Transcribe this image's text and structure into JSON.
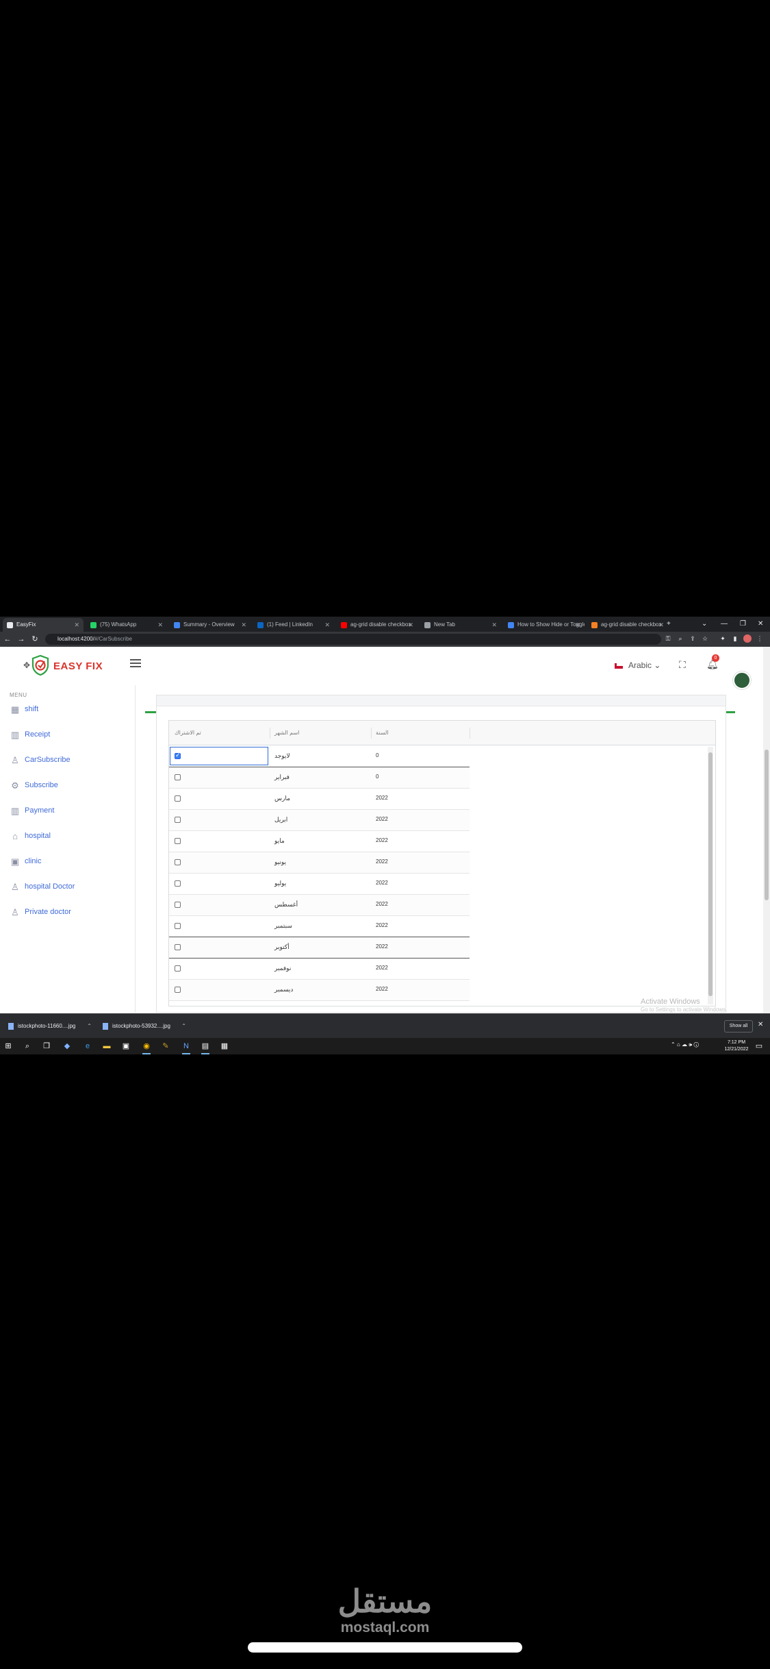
{
  "browser": {
    "tabs": [
      {
        "label": "EasyFix",
        "active": true,
        "color": "#e8eaed"
      },
      {
        "label": "(75) WhatsApp",
        "active": false,
        "color": "#25d366"
      },
      {
        "label": "Summary - Overview",
        "active": false,
        "color": "#4285f4"
      },
      {
        "label": "(1) Feed | LinkedIn",
        "active": false,
        "color": "#0a66c2"
      },
      {
        "label": "ag-grid disable checkbox",
        "active": false,
        "color": "#ff0000"
      },
      {
        "label": "New Tab",
        "active": false,
        "color": "#9aa0a6"
      },
      {
        "label": "How to Show Hide or Toggle",
        "active": false,
        "color": "#4285f4"
      },
      {
        "label": "ag-grid disable checkbox",
        "active": false,
        "color": "#f48024"
      }
    ],
    "url_host": "localhost:4200/",
    "url_path": "#/CarSubscribe"
  },
  "header": {
    "logo_text": "EASY FIX",
    "language": "Arabic",
    "notification_count": "0",
    "accent_color": "#2ea043"
  },
  "sidebar": {
    "menu_label": "MENU",
    "items": [
      {
        "label": "shift",
        "icon": "grid-icon"
      },
      {
        "label": "Receipt",
        "icon": "building-icon"
      },
      {
        "label": "CarSubscribe",
        "icon": "user-icon"
      },
      {
        "label": "Subscribe",
        "icon": "settings-icon"
      },
      {
        "label": "Payment",
        "icon": "building-icon"
      },
      {
        "label": "hospital",
        "icon": "home-icon"
      },
      {
        "label": "clinic",
        "icon": "image-icon"
      },
      {
        "label": "hospital Doctor",
        "icon": "user-add-icon"
      },
      {
        "label": "Private doctor",
        "icon": "user-icon"
      }
    ]
  },
  "grid": {
    "headers": {
      "subscribed": "تم الاشتراك",
      "month_name": "اسم الشهر",
      "year": "السنة"
    },
    "rows": [
      {
        "month": "لايوجد",
        "year": "0",
        "checked": true,
        "focused": true
      },
      {
        "month": "فبراير",
        "year": "0",
        "checked": false
      },
      {
        "month": "مارس",
        "year": "2022",
        "checked": false
      },
      {
        "month": "ابريل",
        "year": "2022",
        "checked": false
      },
      {
        "month": "مايو",
        "year": "2022",
        "checked": false
      },
      {
        "month": "يونيو",
        "year": "2022",
        "checked": false
      },
      {
        "month": "يوليو",
        "year": "2022",
        "checked": false
      },
      {
        "month": "أغسطس",
        "year": "2022",
        "checked": false
      },
      {
        "month": "سبتمبر",
        "year": "2022",
        "checked": false
      },
      {
        "month": "أكتوبر",
        "year": "2022",
        "checked": false
      },
      {
        "month": "نوفمبر",
        "year": "2022",
        "checked": false
      },
      {
        "month": "ديسمبر",
        "year": "2022",
        "checked": false
      }
    ]
  },
  "windows": {
    "activate_title": "Activate Windows",
    "activate_sub": "Go to Settings to activate Windows."
  },
  "downloads": {
    "items": [
      "istockphoto-11660....jpg",
      "istockphoto-53932....jpg"
    ],
    "show_all": "Show all"
  },
  "taskbar": {
    "time": "7:12 PM",
    "date": "12/21/2022"
  },
  "watermark": {
    "arabic": "مستقل",
    "latin": "mostaql.com"
  }
}
